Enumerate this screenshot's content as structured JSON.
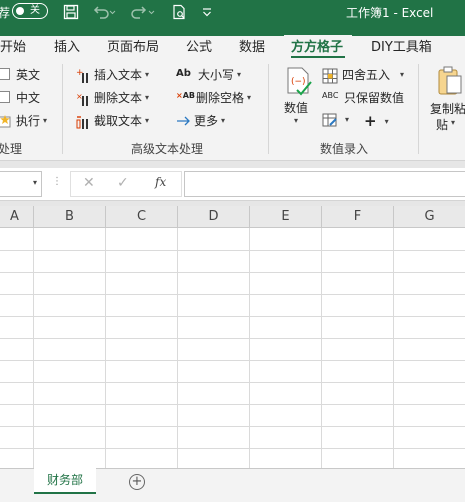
{
  "titlebar": {
    "fragment": "荐",
    "autosave_label": "关",
    "doc_title": "工作簿1  -  Excel"
  },
  "tabs": [
    {
      "label": "开始"
    },
    {
      "label": "插入"
    },
    {
      "label": "页面布局"
    },
    {
      "label": "公式"
    },
    {
      "label": "数据"
    },
    {
      "label": "方方格子"
    },
    {
      "label": "DIY工具箱"
    }
  ],
  "ribbon": {
    "left_group": {
      "items": [
        "英文",
        "中文",
        "执行"
      ],
      "label": "处理"
    },
    "text_group": {
      "col1": [
        "插入文本",
        "删除文本",
        "截取文本"
      ],
      "col2": [
        "大小写",
        "删除空格",
        "更多"
      ],
      "label": "高级文本处理"
    },
    "number_group": {
      "big_button": "数值",
      "items": [
        "四舍五入",
        "只保留数值"
      ],
      "label": "数值录入"
    },
    "copy_group": {
      "label_line1": "复制粘",
      "label_line2": "贴"
    }
  },
  "formula_bar": {
    "fx_label": "fx"
  },
  "columns": [
    "A",
    "B",
    "C",
    "D",
    "E",
    "F",
    "G"
  ],
  "sheet": {
    "name": "财务部",
    "add_label": "+"
  },
  "colors": {
    "accent": "#217346"
  }
}
